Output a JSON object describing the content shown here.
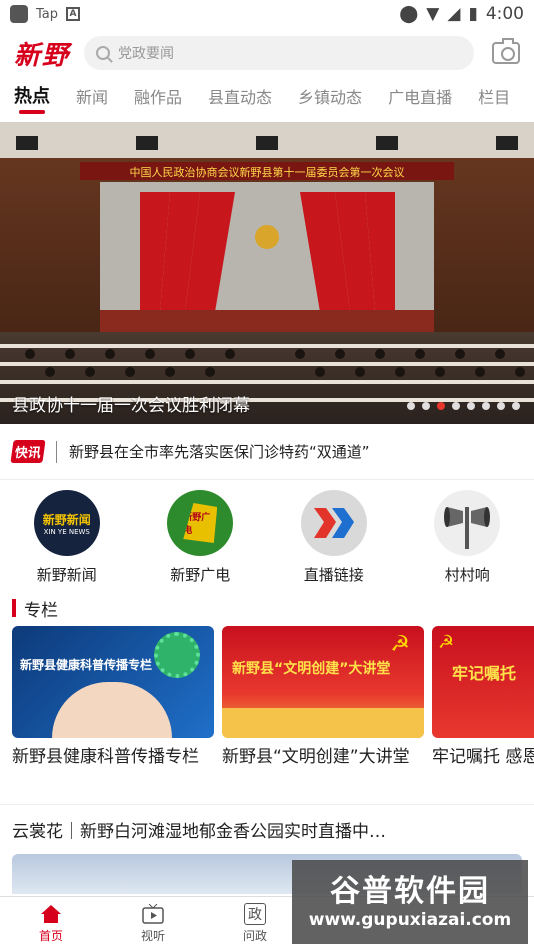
{
  "status": {
    "app": "Tap",
    "time": "4:00"
  },
  "header": {
    "logo": "新野",
    "search_placeholder": "党政要闻"
  },
  "tabs": [
    "热点",
    "新闻",
    "融作品",
    "县直动态",
    "乡镇动态",
    "广电直播",
    "栏目"
  ],
  "banner": {
    "stage_text": "中国人民政治协商会议新野县第十一届委员会第一次会议",
    "caption": "县政协十一届一次会议胜利闭幕",
    "dot_count": 8,
    "active_dot": 2
  },
  "flash": {
    "badge": "快讯",
    "text": "新野县在全市率先落实医保门诊特药“双通道”"
  },
  "quick": [
    {
      "label": "新野新闻",
      "logo_text": "新野新闻",
      "sub": "XIN YE NEWS"
    },
    {
      "label": "新野广电",
      "logo_text": "新野广电"
    },
    {
      "label": "直播链接"
    },
    {
      "label": "村村响"
    }
  ],
  "column": {
    "title": "专栏",
    "cards": [
      {
        "title": "新野县健康科普传播专栏",
        "img_text": "新野县健康科普传播专栏"
      },
      {
        "title": "新野县“文明创建”大讲堂",
        "img_text": "新野县“文明创建”大讲堂"
      },
      {
        "title": "牢记嘱托 感恩",
        "img_text": "牢记嘱托"
      }
    ]
  },
  "live": {
    "title": "云裳花｜新野白河滩湿地郁金香公园实时直播中…"
  },
  "bottom_nav": [
    {
      "label": "首页",
      "active": true
    },
    {
      "label": "视听",
      "active": false
    },
    {
      "label": "问政",
      "active": false
    },
    {
      "label": "",
      "active": false
    },
    {
      "label": "",
      "active": false
    }
  ],
  "watermark": {
    "title": "谷普软件园",
    "url": "www.gupuxiazai.com"
  },
  "colors": {
    "brand_red": "#d6001c",
    "dot_active": "#e8382e"
  }
}
